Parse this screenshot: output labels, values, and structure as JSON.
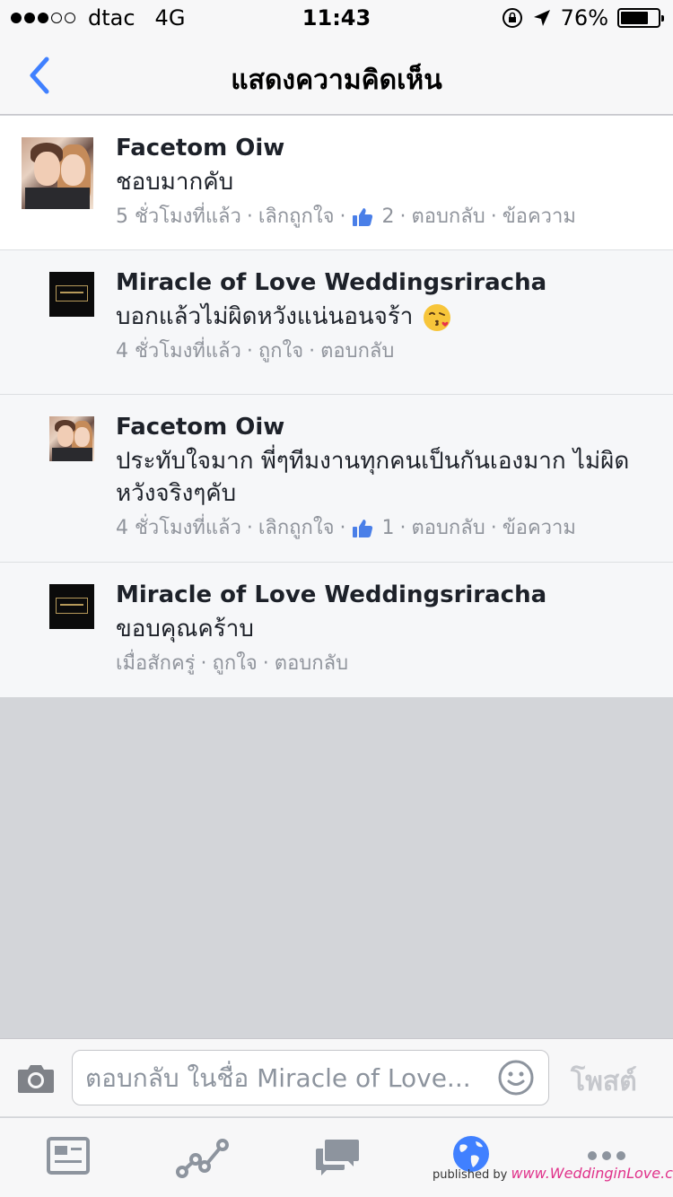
{
  "status_bar": {
    "signal_filled": 3,
    "signal_total": 5,
    "carrier": "dtac",
    "network": "4G",
    "time": "11:43",
    "battery_percent_label": "76%",
    "battery_level": 0.76
  },
  "nav": {
    "title": "แสดงความคิดเห็น",
    "back_icon": "chevron-left-icon"
  },
  "comments": [
    {
      "name": "Facetom Oiw",
      "text": "ชอบมากคับ",
      "time": "5 ชั่วโมงที่แล้ว",
      "like_action": "เลิกถูกใจ",
      "like_count": "2",
      "reply_action": "ตอบกลับ",
      "message_action": "ข้อความ"
    },
    {
      "name": "Miracle of Love Weddingsriracha",
      "text": "บอกแล้วไม่ผิดหวังแน่นอนจร้า",
      "time": "4 ชั่วโมงที่แล้ว",
      "like_action": "ถูกใจ",
      "reply_action": "ตอบกลับ"
    },
    {
      "name": "Facetom Oiw",
      "text": "ประทับใจมาก พี่ๆทีมงานทุกคนเป็นกันเองมาก ไม่ผิดหวังจริงๆคับ",
      "time": "4 ชั่วโมงที่แล้ว",
      "like_action": "เลิกถูกใจ",
      "like_count": "1",
      "reply_action": "ตอบกลับ",
      "message_action": "ข้อความ"
    },
    {
      "name": "Miracle of Love Weddingsriracha",
      "text": "ขอบคุณคร้าบ",
      "time": "เมื่อสักครู่",
      "like_action": "ถูกใจ",
      "reply_action": "ตอบกลับ"
    }
  ],
  "composer": {
    "placeholder": "ตอบกลับ ในชื่อ Miracle of Love...",
    "post_label": "โพสต์"
  },
  "tabs": [
    "news-feed-icon",
    "activity-icon",
    "messages-icon",
    "globe-icon",
    "more-icon"
  ],
  "watermark": {
    "prefix": "published by",
    "site": "www.WeddinginLove.com"
  },
  "colors": {
    "accent": "#4080ff",
    "muted_text": "#90949c",
    "reply_bg": "#f6f7f9",
    "empty_area": "#d3d5d9"
  }
}
